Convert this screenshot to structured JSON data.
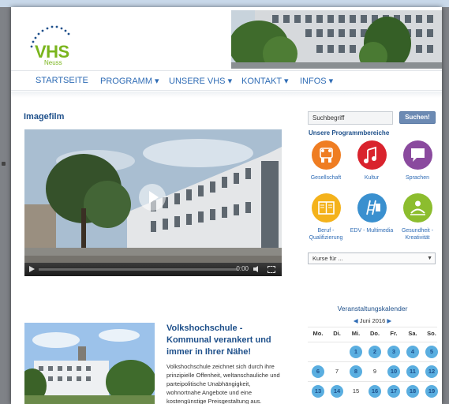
{
  "logo": {
    "text": "VHS",
    "subtext": "Neuss"
  },
  "nav": {
    "items": [
      {
        "label": "STARTSEITE"
      },
      {
        "label": "PROGRAMM ▾"
      },
      {
        "label": "UNSERE VHS ▾"
      },
      {
        "label": "KONTAKT ▾"
      },
      {
        "label": "INFOS ▾"
      }
    ]
  },
  "main": {
    "section_title": "Imagefilm",
    "video": {
      "time": "0:00",
      "play_icon": "play-icon"
    },
    "article": {
      "title": "Volkshochschule - Kommunal verankert und immer in Ihrer Nähe!",
      "body": "Volkshochschule zeichnet sich durch ihre prinzipielle Offenheit, weltanschauliche und parteipolitische Unabhängigkeit, wohnortnahe Angebote und eine kostengünstige Preisgestaltung aus."
    }
  },
  "sidebar": {
    "search": {
      "value": "Suchbegriff",
      "button_label": "Suchen!"
    },
    "program_title": "Unsere Programmbereiche",
    "programs": [
      {
        "label": "Gesellschaft",
        "color": "#ef7d22",
        "icon": "people-icon"
      },
      {
        "label": "Kultur",
        "color": "#d9232d",
        "icon": "music-note-icon"
      },
      {
        "label": "Sprachen",
        "color": "#8a4a9e",
        "icon": "speech-bubble-icon"
      },
      {
        "label": "Beruf - Qualifizierung",
        "color": "#f4b21b",
        "icon": "book-icon"
      },
      {
        "label": "EDV - Multimedia",
        "color": "#3a90cf",
        "icon": "ladder-icon"
      },
      {
        "label": "Gesundheit - Kreativität",
        "color": "#8cbd2e",
        "icon": "health-icon"
      }
    ],
    "select_value": "Kurse für ...",
    "calendar": {
      "title": "Veranstaltungskalender",
      "month": "Juni 2016",
      "prev_icon": "arrow-left-icon",
      "next_icon": "arrow-right-icon",
      "weekdays": [
        "Mo.",
        "Di.",
        "Mi.",
        "Do.",
        "Fr.",
        "Sa.",
        "So."
      ],
      "weeks": [
        [
          {
            "d": "",
            "e": false
          },
          {
            "d": "",
            "e": false
          },
          {
            "d": "1",
            "e": true
          },
          {
            "d": "2",
            "e": true
          },
          {
            "d": "3",
            "e": true
          },
          {
            "d": "4",
            "e": true
          },
          {
            "d": "5",
            "e": true
          }
        ],
        [
          {
            "d": "6",
            "e": true
          },
          {
            "d": "7",
            "e": false
          },
          {
            "d": "8",
            "e": true
          },
          {
            "d": "9",
            "e": false
          },
          {
            "d": "10",
            "e": true
          },
          {
            "d": "11",
            "e": true
          },
          {
            "d": "12",
            "e": true
          }
        ],
        [
          {
            "d": "13",
            "e": true
          },
          {
            "d": "14",
            "e": true
          },
          {
            "d": "15",
            "e": false
          },
          {
            "d": "16",
            "e": true
          },
          {
            "d": "17",
            "e": true
          },
          {
            "d": "18",
            "e": true
          },
          {
            "d": "19",
            "e": true
          }
        ]
      ]
    }
  }
}
